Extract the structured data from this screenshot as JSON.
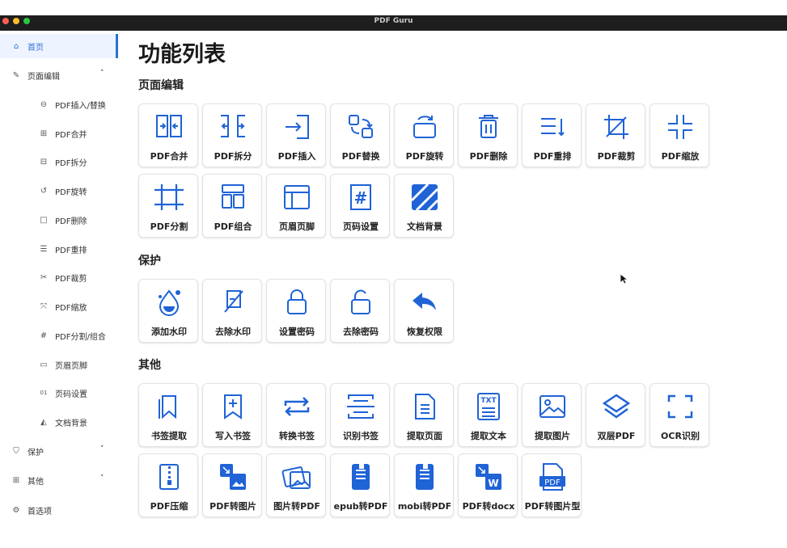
{
  "window": {
    "title": "PDF Guru"
  },
  "sidebar": {
    "items": [
      {
        "label": "首页",
        "icon": "home-icon"
      },
      {
        "label": "页面编辑",
        "icon": "edit-icon"
      },
      {
        "label": "PDF插入/替换",
        "icon": "insert-icon"
      },
      {
        "label": "PDF合并",
        "icon": "merge-icon"
      },
      {
        "label": "PDF拆分",
        "icon": "split-icon"
      },
      {
        "label": "PDF旋转",
        "icon": "rotate-icon"
      },
      {
        "label": "PDF删除",
        "icon": "delete-icon"
      },
      {
        "label": "PDF重排",
        "icon": "reorder-icon"
      },
      {
        "label": "PDF裁剪",
        "icon": "scissors-icon"
      },
      {
        "label": "PDF缩放",
        "icon": "scale-icon"
      },
      {
        "label": "PDF分割/组合",
        "icon": "hash-icon"
      },
      {
        "label": "页眉页脚",
        "icon": "header-footer-icon"
      },
      {
        "label": "页码设置",
        "icon": "page-number-icon"
      },
      {
        "label": "文档背景",
        "icon": "background-icon"
      },
      {
        "label": "保护",
        "icon": "shield-icon"
      },
      {
        "label": "其他",
        "icon": "grid-icon"
      },
      {
        "label": "首选项",
        "icon": "gear-icon"
      }
    ]
  },
  "main": {
    "title": "功能列表",
    "sections": [
      {
        "title": "页面编辑",
        "tiles": [
          "PDF合并",
          "PDF拆分",
          "PDF插入",
          "PDF替换",
          "PDF旋转",
          "PDF删除",
          "PDF重排",
          "PDF裁剪",
          "PDF缩放",
          "PDF分割",
          "PDF组合",
          "页眉页脚",
          "页码设置",
          "文档背景"
        ]
      },
      {
        "title": "保护",
        "tiles": [
          "添加水印",
          "去除水印",
          "设置密码",
          "去除密码",
          "恢复权限"
        ]
      },
      {
        "title": "其他",
        "tiles": [
          "书签提取",
          "写入书签",
          "转换书签",
          "识别书签",
          "提取页面",
          "提取文本",
          "提取图片",
          "双层PDF",
          "OCR识别",
          "PDF压缩",
          "PDF转图片",
          "图片转PDF",
          "epub转PDF",
          "mobi转PDF",
          "PDF转docx",
          "PDF转图片型"
        ]
      }
    ]
  },
  "icon_texts": {
    "page_number": "#",
    "txt": "TXT",
    "pdf": "PDF",
    "word": "W",
    "ordinal": "01"
  },
  "colors": {
    "accent": "#2b6fd8",
    "icon_blue": "#1f63d6",
    "text": "#222222"
  }
}
